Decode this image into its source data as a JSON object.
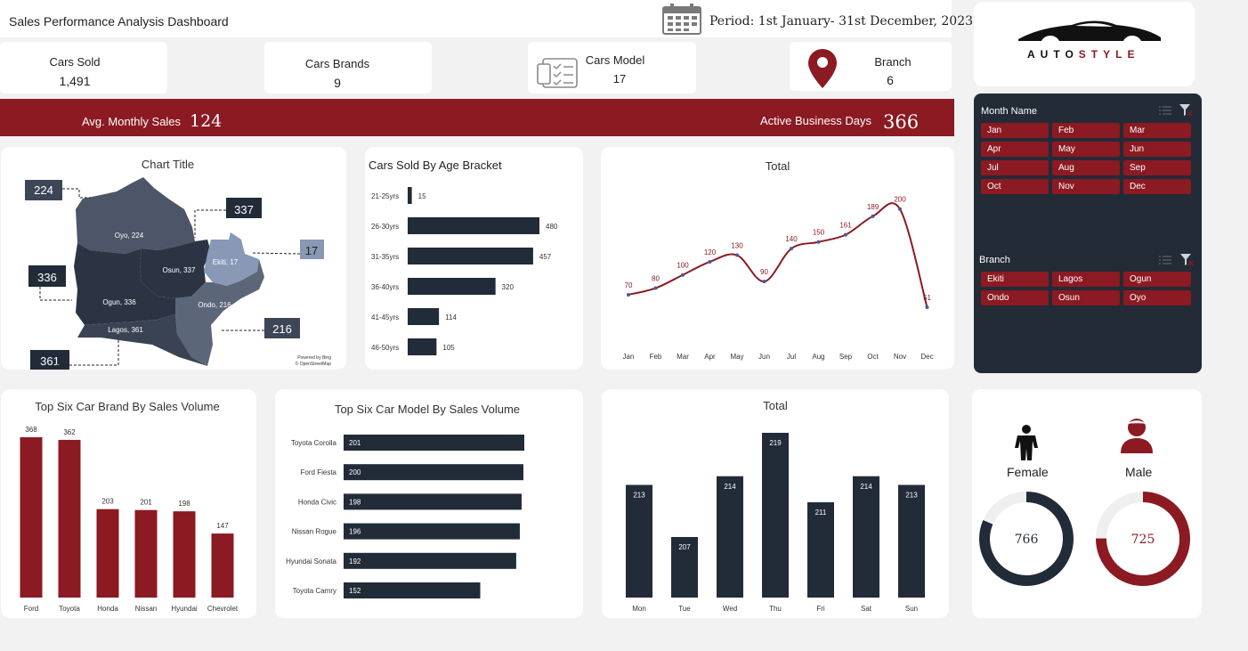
{
  "header": {
    "title": "Sales Performance Analysis Dashboard",
    "period": "Period: 1st January- 31st December, 2023",
    "calendar_icon": "calendar-icon"
  },
  "kpis": {
    "cars_sold": {
      "label": "Cars Sold",
      "value": "1,491"
    },
    "brands": {
      "label": "Cars Brands",
      "value": "9"
    },
    "models": {
      "label": "Cars Model",
      "value": "17"
    },
    "branch": {
      "label": "Branch",
      "value": "6"
    }
  },
  "logo": {
    "text": "AUTO STYLE",
    "part1": "AUTO",
    "part2": "STYLE"
  },
  "banner": {
    "avg_label": "Avg. Monthly Sales",
    "avg_value": "124",
    "days_label": "Active Business Days",
    "days_value": "366"
  },
  "colors": {
    "accent": "#8b1a22",
    "dark": "#222b38",
    "background": "#f2f2f2"
  },
  "map": {
    "title": "Chart Title",
    "regions": [
      {
        "name": "Oyo",
        "value": 224,
        "label": "Oyo, 224"
      },
      {
        "name": "Osun",
        "value": 337,
        "label": "Osun, 337"
      },
      {
        "name": "Ekiti",
        "value": 17,
        "label": "Ekiti, 17"
      },
      {
        "name": "Ogun",
        "value": 336,
        "label": "Ogun, 336"
      },
      {
        "name": "Ondo",
        "value": 216,
        "label": "Ondo, 216"
      },
      {
        "name": "Lagos",
        "value": 361,
        "label": "Lagos, 361"
      }
    ],
    "callouts": [
      "224",
      "337",
      "17",
      "336",
      "216",
      "361"
    ],
    "credit1": "Powered by Bing",
    "credit2": "© OpenStreetMap"
  },
  "slicers": {
    "month": {
      "title": "Month Name",
      "items": [
        "Jan",
        "Feb",
        "Mar",
        "Apr",
        "May",
        "Jun",
        "Jul",
        "Aug",
        "Sep",
        "Oct",
        "Nov",
        "Dec"
      ]
    },
    "branch": {
      "title": "Branch",
      "items": [
        "Ekiti",
        "Lagos",
        "Ogun",
        "Ondo",
        "Osun",
        "Oyo"
      ]
    }
  },
  "gender": {
    "female": {
      "label": "Female",
      "value": 766
    },
    "male": {
      "label": "Male",
      "value": 725
    }
  },
  "chart_data": [
    {
      "id": "age",
      "type": "bar",
      "orientation": "horizontal",
      "title": "Cars Sold By Age Bracket",
      "categories": [
        "21-25yrs",
        "26-30yrs",
        "31-35yrs",
        "36-40yrs",
        "41-45yrs",
        "46-50yrs"
      ],
      "values": [
        15,
        480,
        457,
        320,
        114,
        105
      ]
    },
    {
      "id": "monthly",
      "type": "line",
      "title": "Total",
      "categories": [
        "Jan",
        "Feb",
        "Mar",
        "Apr",
        "May",
        "Jun",
        "Jul",
        "Aug",
        "Sep",
        "Oct",
        "Nov",
        "Dec"
      ],
      "values": [
        70,
        80,
        100,
        120,
        130,
        90,
        140,
        150,
        161,
        189,
        200,
        51
      ]
    },
    {
      "id": "brand",
      "type": "bar",
      "title": "Top Six Car Brand By Sales Volume",
      "categories": [
        "Ford",
        "Toyota",
        "Honda",
        "Nissan",
        "Hyundai",
        "Chevrolet"
      ],
      "values": [
        368,
        362,
        203,
        201,
        198,
        147
      ]
    },
    {
      "id": "model",
      "type": "bar",
      "orientation": "horizontal",
      "title": "Top Six Car Model By Sales Volume",
      "categories": [
        "Toyota Corolla",
        "Ford Fiesta",
        "Honda Civic",
        "Nissan Rogue",
        "Hyundai Sonata",
        "Toyota Camry"
      ],
      "values": [
        201,
        200,
        198,
        196,
        192,
        152
      ]
    },
    {
      "id": "weekday",
      "type": "bar",
      "title": "Total",
      "categories": [
        "Mon",
        "Tue",
        "Wed",
        "Thu",
        "Fri",
        "Sat",
        "Sun"
      ],
      "values": [
        213,
        207,
        214,
        219,
        211,
        214,
        213
      ]
    }
  ]
}
